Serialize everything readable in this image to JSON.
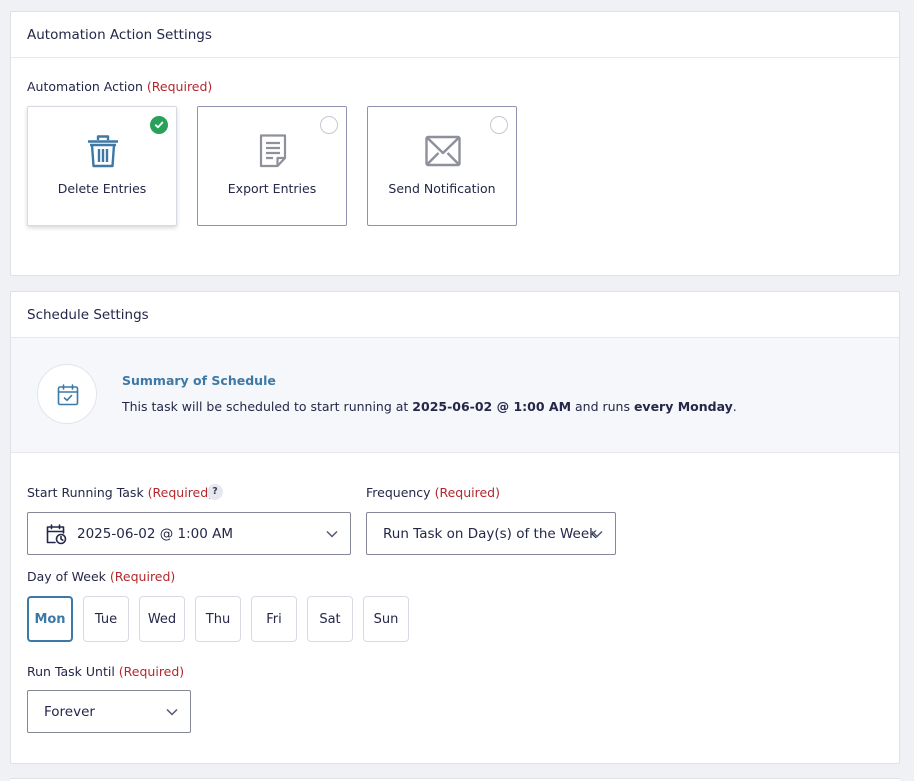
{
  "action_panel": {
    "title": "Automation Action Settings",
    "field_label": "Automation Action",
    "required_text": "(Required)",
    "actions": [
      {
        "label": "Delete Entries",
        "icon": "trash-icon",
        "selected": true
      },
      {
        "label": "Export Entries",
        "icon": "document-icon",
        "selected": false
      },
      {
        "label": "Send Notification",
        "icon": "envelope-icon",
        "selected": false
      }
    ]
  },
  "schedule_panel": {
    "title": "Schedule Settings",
    "summary": {
      "title": "Summary of Schedule",
      "text_prefix": "This task will be scheduled to start running at ",
      "start": "2025-06-02 @ 1:00 AM",
      "text_middle": " and runs ",
      "frequency": "every Monday",
      "text_suffix": "."
    },
    "start_task": {
      "label": "Start Running Task",
      "required_text": "(Required)",
      "help": "?",
      "value": "2025-06-02 @ 1:00 AM"
    },
    "frequency": {
      "label": "Frequency",
      "required_text": "(Required)",
      "value": "Run Task on Day(s) of the Week"
    },
    "day_of_week": {
      "label": "Day of Week",
      "required_text": "(Required)",
      "days": [
        "Mon",
        "Tue",
        "Wed",
        "Thu",
        "Fri",
        "Sat",
        "Sun"
      ],
      "selected": "Mon"
    },
    "run_until": {
      "label": "Run Task Until",
      "required_text": "(Required)",
      "value": "Forever"
    }
  },
  "colors": {
    "accent": "#3d79a6",
    "required": "#b3282d",
    "check": "#2aa15b",
    "icon_gray": "#8e909b"
  }
}
